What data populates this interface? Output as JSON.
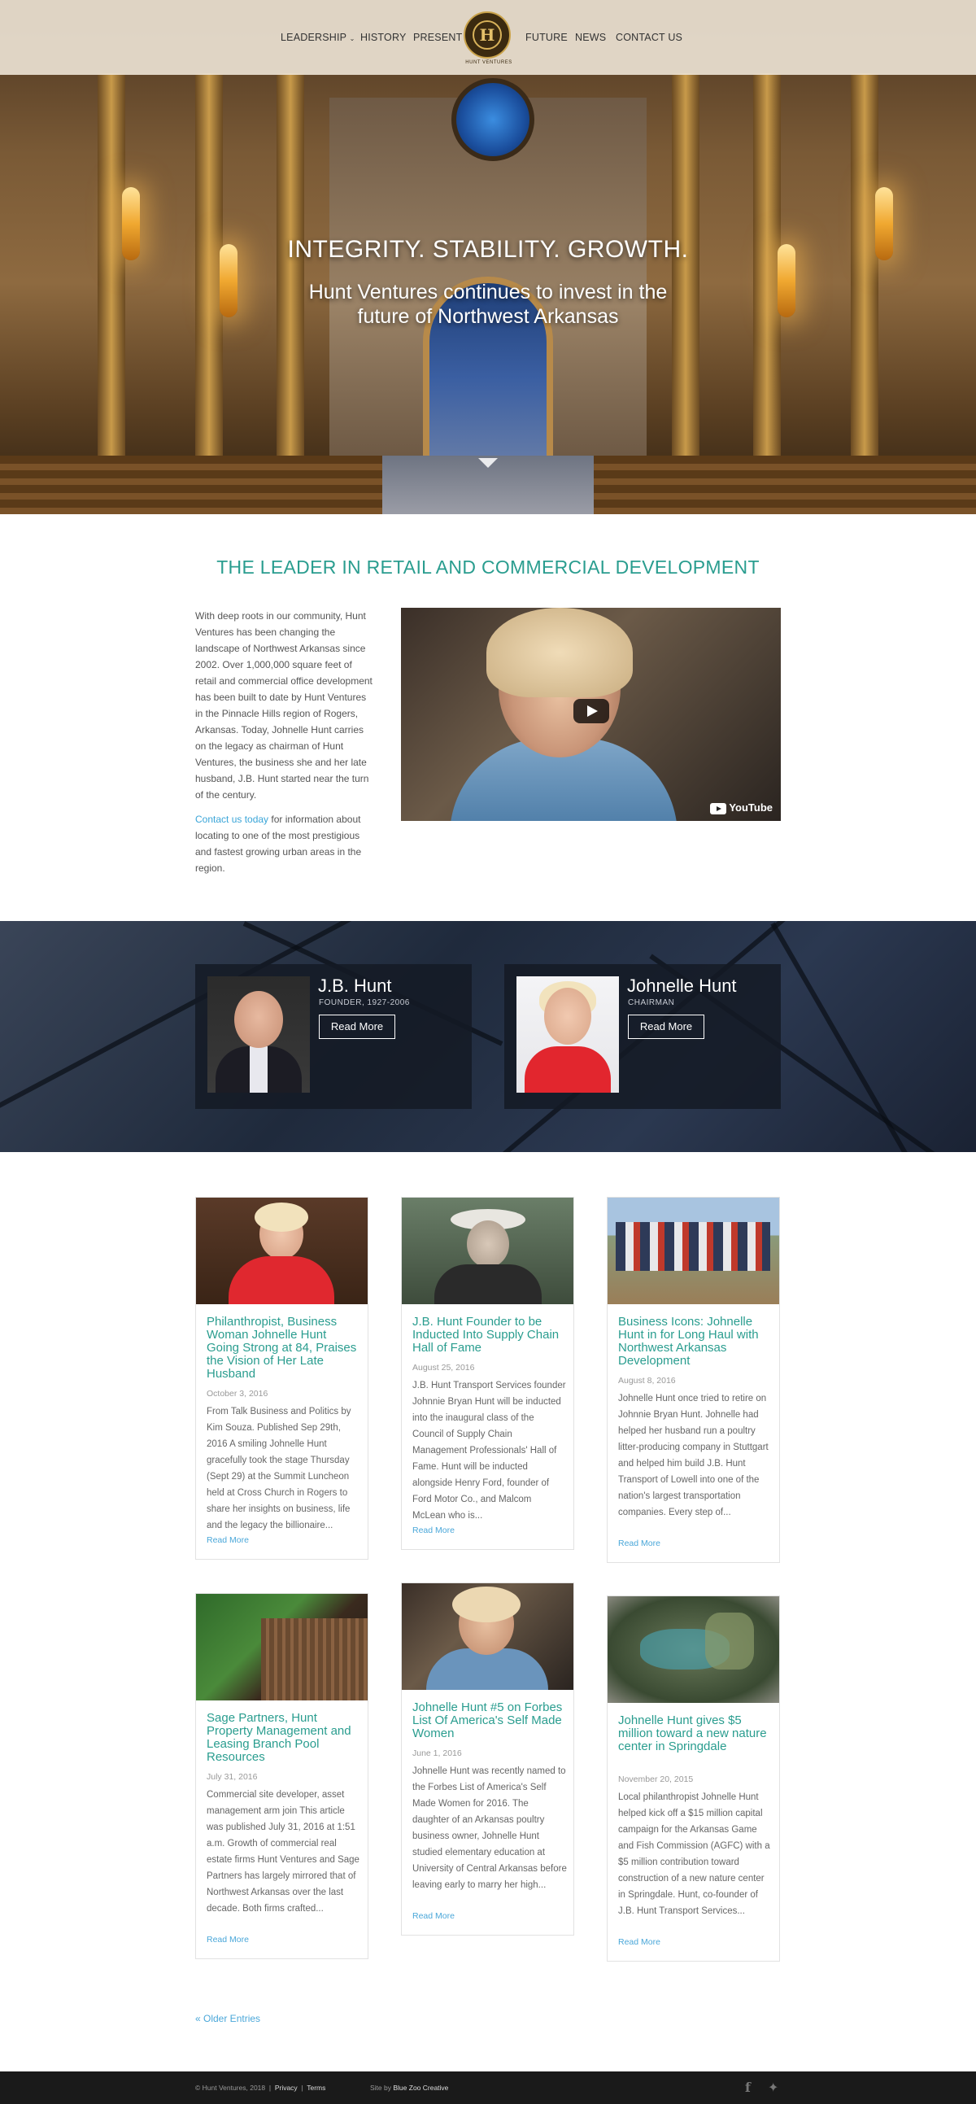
{
  "nav": {
    "items_left": [
      "LEADERSHIP",
      "HISTORY",
      "PRESENT"
    ],
    "items_right": [
      "FUTURE",
      "NEWS",
      "CONTACT US"
    ],
    "logo_letter": "H",
    "logo_text": "HUNT VENTURES",
    "leadership_chevron": "chevron-down-icon"
  },
  "hero": {
    "headline": "INTEGRITY. STABILITY. GROWTH.",
    "subheadline": "Hunt Ventures continues to invest in the future of Northwest Arkansas"
  },
  "intro": {
    "title": "THE LEADER IN RETAIL AND COMMERCIAL DEVELOPMENT",
    "paragraph1": "With deep roots in our community, Hunt Ventures has been changing the landscape of Northwest Arkansas since 2002. Over 1,000,000 square feet of retail and commercial office development has been built to date by Hunt Ventures in the Pinnacle Hills region of Rogers, Arkansas. Today, Johnelle Hunt carries on the legacy as chairman of Hunt Ventures, the business she and her late husband, J.B. Hunt started near the turn of the century.",
    "contact_link": "Contact us today",
    "paragraph2_rest": " for information about locating to one of the most prestigious and fastest growing urban areas in the region.",
    "video_brand": "YouTube"
  },
  "people": [
    {
      "name": "J.B. Hunt",
      "role": "FOUNDER, 1927-2006",
      "button": "Read More"
    },
    {
      "name": "Johnelle Hunt",
      "role": "CHAIRMAN",
      "button": "Read More"
    }
  ],
  "posts": [
    {
      "title": "Philanthropist, Business Woman Johnelle Hunt Going Strong at 84, Praises the Vision of Her Late Husband",
      "date": "October 3, 2016",
      "excerpt": "From Talk Business and Politics by Kim Souza. Published Sep 29th, 2016 A smiling Johnelle Hunt gracefully took the stage Thursday (Sept 29) at the Summit Luncheon held at Cross Church in Rogers to share her insights on business, life and the legacy the billionaire...",
      "more": "Read More"
    },
    {
      "title": "J.B. Hunt Founder to be Inducted Into Supply Chain Hall of Fame",
      "date": "August 25, 2016",
      "excerpt": "J.B. Hunt Transport Services founder Johnnie Bryan Hunt will be inducted into the inaugural class of the Council of Supply Chain Management Professionals' Hall of Fame. Hunt will be inducted alongside Henry Ford, founder of Ford Motor Co., and Malcom McLean who is...",
      "more": "Read More"
    },
    {
      "title": "Business Icons: Johnelle Hunt in for Long Haul with Northwest Arkansas Development",
      "date": "August 8, 2016",
      "excerpt": "Johnelle Hunt once tried to retire on Johnnie Bryan Hunt. Johnelle had helped her husband run a poultry litter-producing company in Stuttgart and helped him build J.B. Hunt Transport of Lowell into one of the nation's largest transportation companies. Every step of...",
      "more": "Read More"
    },
    {
      "title": "Sage Partners, Hunt Property Management and Leasing Branch Pool Resources",
      "date": "July 31, 2016",
      "excerpt": "Commercial site developer, asset management arm join This article was published July 31, 2016 at 1:51 a.m. Growth of commercial real estate firms Hunt Ventures and Sage Partners has largely mirrored that of Northwest Arkansas over the last decade. Both firms crafted...",
      "more": "Read More"
    },
    {
      "title": "Johnelle Hunt #5 on Forbes List Of America's Self Made Women",
      "date": "June 1, 2016",
      "excerpt": "Johnelle Hunt was recently named to the Forbes List of America's Self Made Women for 2016. The daughter of an Arkansas poultry business owner, Johnelle Hunt studied elementary education at University of Central Arkansas before leaving early to marry her high...",
      "more": "Read More"
    },
    {
      "title": "Johnelle Hunt gives $5 million toward a new nature center in Springdale",
      "date": "November 20, 2015",
      "excerpt": "Local philanthropist Johnelle Hunt helped kick off a $15 million capital campaign for the Arkansas Game and Fish Commission (AGFC) with a $5 million contribution toward construction of a new nature center in Springdale. Hunt, co-founder of J.B. Hunt Transport Services...",
      "more": "Read More"
    }
  ],
  "older_entries": "« Older Entries",
  "footer": {
    "copyright": "© Hunt Ventures, 2018",
    "sep": "|",
    "privacy": "Privacy",
    "terms": "Terms",
    "site_by_prefix": "Site by",
    "site_by": "Blue Zoo Creative",
    "social": [
      "facebook-icon",
      "twitter-icon"
    ]
  }
}
